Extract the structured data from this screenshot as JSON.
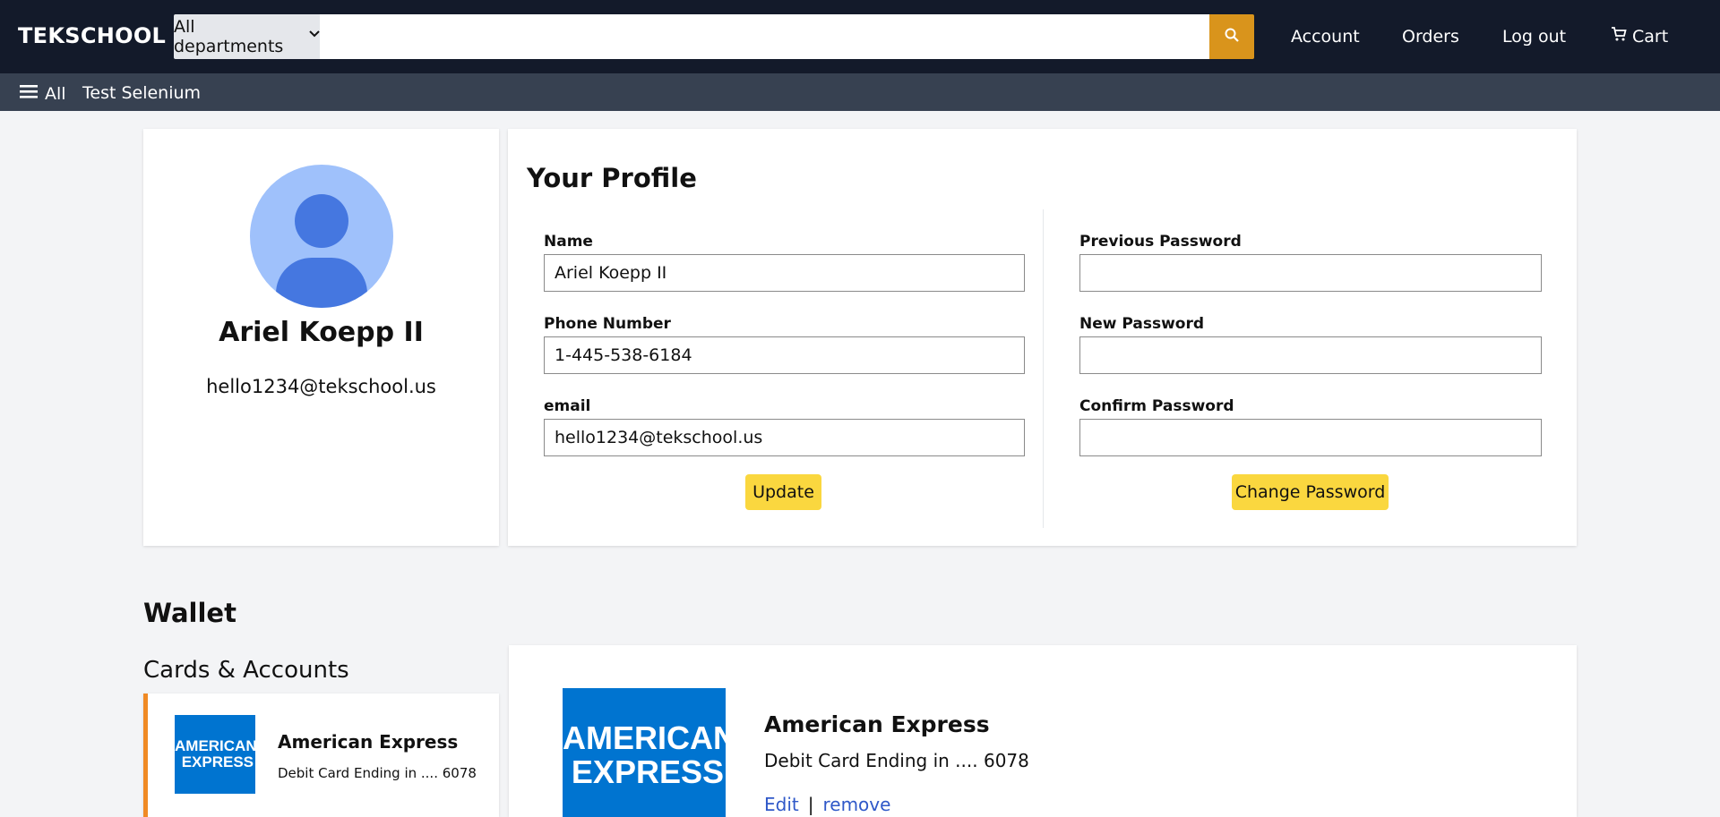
{
  "header": {
    "brand": "TEKSCHOOL",
    "department_select": "All departments",
    "search_placeholder": "",
    "nav": {
      "account": "Account",
      "orders": "Orders",
      "logout": "Log out",
      "cart": "Cart"
    }
  },
  "subnav": {
    "all": "All",
    "test": "Test Selenium"
  },
  "profile": {
    "name": "Ariel Koepp II",
    "email": "hello1234@tekschool.us"
  },
  "form": {
    "title": "Your Profile",
    "name_label": "Name",
    "name_value": "Ariel Koepp II",
    "phone_label": "Phone Number",
    "phone_value": "1-445-538-6184",
    "email_label": "email",
    "email_value": "hello1234@tekschool.us",
    "update_button": "Update",
    "prev_password_label": "Previous Password",
    "new_password_label": "New Password",
    "confirm_password_label": "Confirm Password",
    "change_password_button": "Change Password"
  },
  "wallet": {
    "title": "Wallet",
    "section": "Cards & Accounts",
    "card_logo": {
      "line1": "AMERICAN",
      "line2": "EXPRESS"
    },
    "card": {
      "name": "American Express",
      "desc": "Debit Card Ending in .... 6078"
    },
    "detail": {
      "name": "American Express",
      "desc": "Debit Card Ending in .... 6078",
      "edit": "Edit",
      "separator": "|",
      "remove": "remove"
    }
  },
  "colors": {
    "topbar": "#131a2a",
    "subbar": "#374151",
    "accent_search": "#d9941c",
    "button_yellow": "#fad73f",
    "amex_blue": "#0074d0",
    "card_active_border": "#f08a24",
    "link": "#2f58c8"
  }
}
